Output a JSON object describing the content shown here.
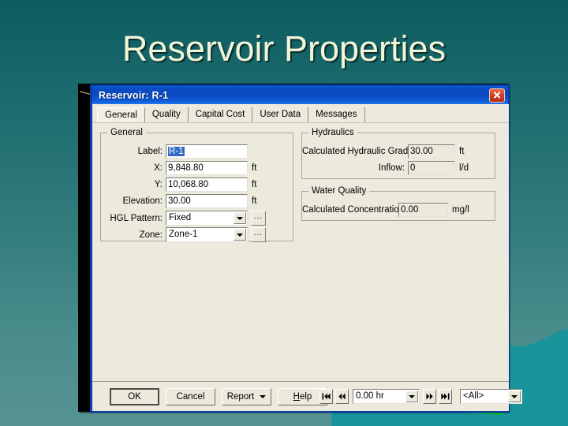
{
  "slide": {
    "title": "Reservoir Properties",
    "background": {
      "top_color": "#0c5c61",
      "bottom_color": "#569392"
    },
    "title_color": "#f2f6d8"
  },
  "dialog": {
    "title": "Reservoir: R-1",
    "titlebar_color": "#0b47bd",
    "close_icon": "close-icon",
    "tabs": [
      {
        "label": "General",
        "active": true
      },
      {
        "label": "Quality",
        "active": false
      },
      {
        "label": "Capital Cost",
        "active": false
      },
      {
        "label": "User Data",
        "active": false
      },
      {
        "label": "Messages",
        "active": false
      }
    ],
    "general_group": {
      "legend": "General",
      "fields": [
        {
          "label": "Label:",
          "value": "R-1",
          "unit": "",
          "type": "text",
          "selected": true
        },
        {
          "label": "X:",
          "value": "9,848.80",
          "unit": "ft",
          "type": "text",
          "selected": false
        },
        {
          "label": "Y:",
          "value": "10,068.80",
          "unit": "ft",
          "type": "text",
          "selected": false
        },
        {
          "label": "Elevation:",
          "value": "30.00",
          "unit": "ft",
          "type": "text",
          "selected": false
        },
        {
          "label": "HGL Pattern:",
          "value": "Fixed",
          "unit": "",
          "type": "combo",
          "ellipsis": "..."
        },
        {
          "label": "Zone:",
          "value": "Zone-1",
          "unit": "",
          "type": "combo",
          "ellipsis": "..."
        }
      ]
    },
    "hydraulics_group": {
      "legend": "Hydraulics",
      "fields": [
        {
          "label": "Calculated Hydraulic Grade:",
          "value": "30.00",
          "unit": "ft"
        },
        {
          "label": "Inflow:",
          "value": "0",
          "unit": "l/d"
        }
      ]
    },
    "water_quality_group": {
      "legend": "Water Quality",
      "fields": [
        {
          "label": "Calculated Concentration:",
          "value": "0.00",
          "unit": "mg/l"
        }
      ]
    },
    "buttons": {
      "ok": "OK",
      "cancel": "Cancel",
      "report": "Report",
      "help_prefix": "H",
      "help_rest": "elp"
    },
    "navigation": {
      "first_icon": "skip-first-icon",
      "prev_icon": "step-back-icon",
      "time_value": "0.00 hr",
      "next_icon": "step-forward-icon",
      "last_icon": "skip-last-icon",
      "filter_value": "<All>"
    }
  }
}
